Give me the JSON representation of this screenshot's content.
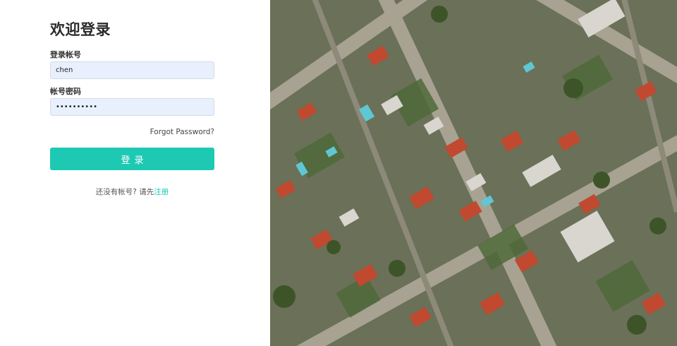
{
  "login": {
    "title": "欢迎登录",
    "account_label": "登录帐号",
    "account_value": "chen",
    "password_label": "帐号密码",
    "password_value": "••••••••••",
    "forgot_link": "Forgot Password?",
    "submit_label": "登录",
    "register_prompt": "还没有帐号? 请先",
    "register_link": "注册"
  },
  "colors": {
    "accent": "#1ec9b4",
    "input_bg": "#e8f0fe"
  }
}
